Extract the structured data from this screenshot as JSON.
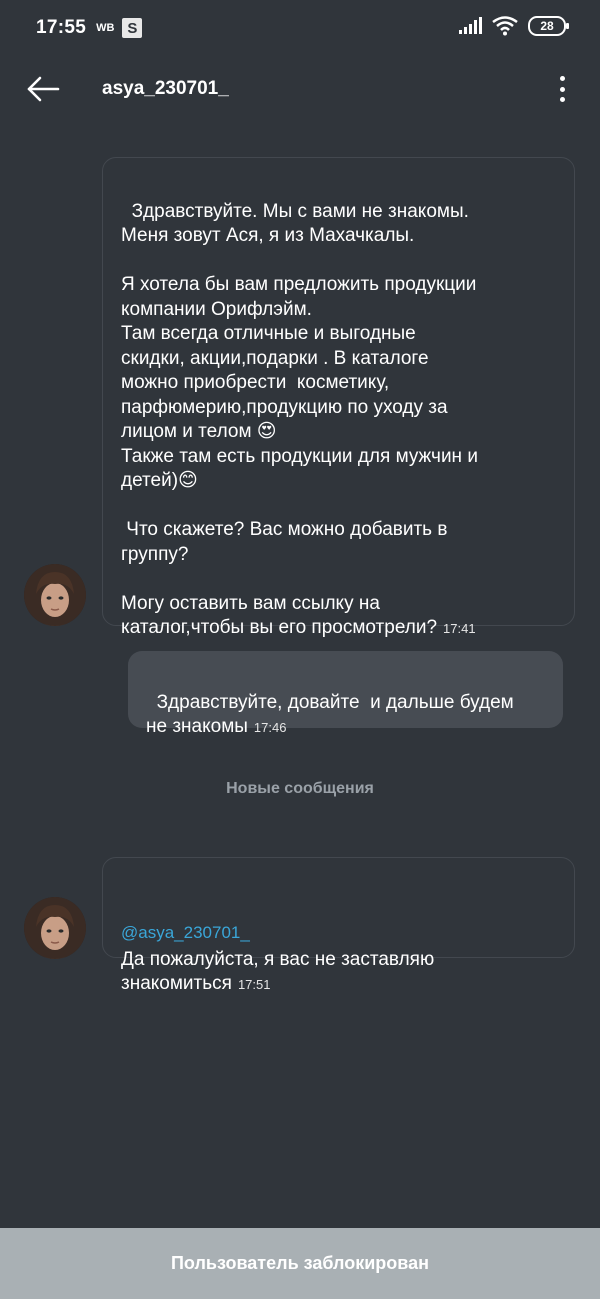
{
  "status_bar": {
    "time": "17:55",
    "carrier_label": "WB",
    "app_badge": "S",
    "battery": "28",
    "icons": [
      "signal-icon",
      "wifi-icon",
      "battery-icon"
    ]
  },
  "header": {
    "title": "asya_230701_",
    "back_icon": "arrow-left-icon",
    "menu_icon": "more-vertical-icon"
  },
  "messages": [
    {
      "direction": "incoming",
      "text": "Здравствуйте. Мы с вами не знакомы.\nМеня зовут Ася, я из Махачкалы.\n\nЯ хотела бы вам предложить продукции\nкомпании Орифлэйм.\nТам всегда отличные и выгодные\nскидки, акции,подарки . В каталоге\nможно приобрести  косметику,\nпарфюмерию,продукцию по уходу за\nлицом и телом 😍\nТакже там есть продукции для мужчин и\nдетей)😊\n\n Что скажете? Вас можно добавить в\nгруппу?\n\nМогу оставить вам ссылку на\nкаталог,чтобы вы его просмотрели?",
      "time": "17:41"
    },
    {
      "direction": "outgoing",
      "text": "Здравствуйте, довайте  и дальше будем\nне знакомы",
      "time": "17:46"
    },
    {
      "direction": "incoming",
      "reply_to": "@asya_230701_",
      "text": "Да пожалуйста, я вас не заставляю\nзнакомиться",
      "time": "17:51"
    }
  ],
  "divider": "Новые сообщения",
  "footer": {
    "blocked_label": "Пользователь заблокирован"
  }
}
